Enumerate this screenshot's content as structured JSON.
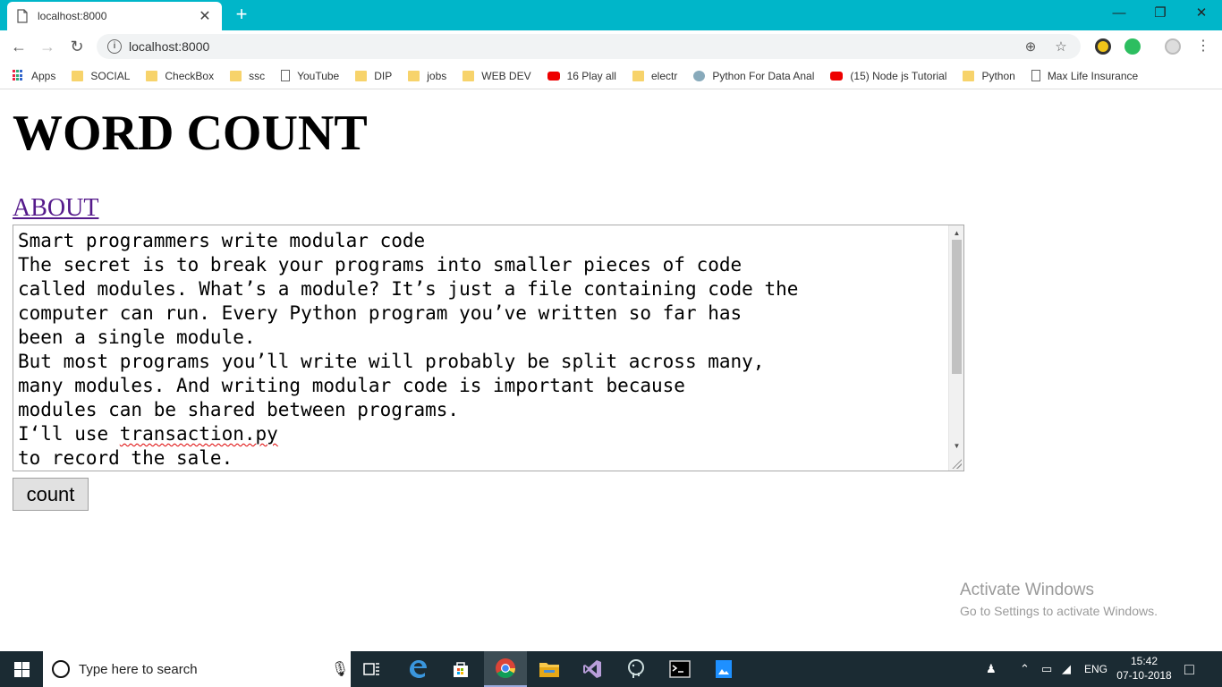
{
  "browser": {
    "tab_title": "localhost:8000",
    "close_tab_glyph": "✕",
    "new_tab_glyph": "+",
    "url": "localhost:8000",
    "bookmarks": [
      {
        "label": "Apps",
        "icon": "apps-icon"
      },
      {
        "label": "SOCIAL",
        "icon": "folder-icon"
      },
      {
        "label": "CheckBox",
        "icon": "folder-icon"
      },
      {
        "label": "ssc",
        "icon": "folder-icon"
      },
      {
        "label": "YouTube",
        "icon": "page-icon"
      },
      {
        "label": "DIP",
        "icon": "folder-icon"
      },
      {
        "label": "jobs",
        "icon": "folder-icon"
      },
      {
        "label": "WEB DEV",
        "icon": "folder-icon"
      },
      {
        "label": "16 Play all",
        "icon": "youtube-icon"
      },
      {
        "label": "electr",
        "icon": "folder-icon"
      },
      {
        "label": "Python For Data Anal",
        "icon": "site-icon"
      },
      {
        "label": "(15) Node js Tutorial",
        "icon": "youtube-icon"
      },
      {
        "label": "Python",
        "icon": "folder-icon"
      },
      {
        "label": "Max Life Insurance",
        "icon": "page-icon"
      }
    ]
  },
  "page": {
    "heading": "WORD COUNT",
    "about_link": "ABOUT",
    "textarea_lines": [
      "Smart programmers write modular code",
      "The secret is to break your programs into smaller pieces of code",
      "called modules. What’s a module? It’s just a file containing code the",
      "computer can run. Every Python program you’ve written so far has",
      "been a single module.",
      "But most programs you’ll write will probably be split across many,",
      "many modules. And writing modular code is important because",
      "modules can be shared between programs.",
      "I‘ll use ",
      "transaction.py",
      "to record the sale."
    ],
    "count_button": "count"
  },
  "watermark": {
    "line1": "Activate Windows",
    "line2": "Go to Settings to activate Windows."
  },
  "taskbar": {
    "search_placeholder": "Type here to search",
    "language": "ENG",
    "time": "15:42",
    "date": "07-10-2018"
  },
  "colors": {
    "tab_bar": "#00b6c9",
    "link_visited": "#551a8b",
    "taskbar": "#1b2b33"
  }
}
